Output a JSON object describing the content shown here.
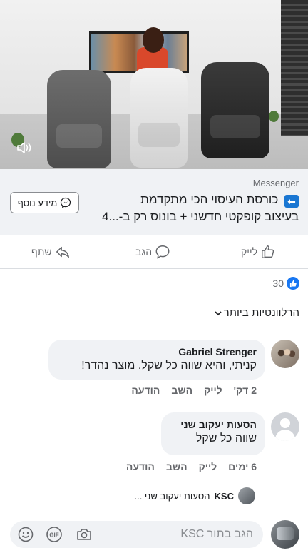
{
  "video": {
    "mute_icon": "speaker-muted-icon"
  },
  "ad": {
    "sponsor": "Messenger",
    "title_line1": "כורסת העיסוי הכי מתקדמת",
    "title_line2": "בעיצוב קופקטי חדשני + בונוס רק ב-...4",
    "arrow_glyph": "⬅",
    "cta_label": "מידע נוסף",
    "cta_icon": "messenger-icon"
  },
  "actions": {
    "like_label": "לייק",
    "comment_label": "הגב",
    "share_label": "שתף"
  },
  "reactions": {
    "count": "30"
  },
  "sort": {
    "label": "הרלוונטיות ביותר"
  },
  "comments": [
    {
      "author": "Gabriel Strenger",
      "text": "קניתי, והיא שווה כל שקל. מוצר נהדר!",
      "time": "2 דק'",
      "like": "לייק",
      "reply": "השב",
      "report": "הודעה"
    },
    {
      "author": "הסעות יעקוב שני",
      "text": "שווה כל שקל",
      "time": "6 ימים",
      "like": "לייק",
      "reply": "השב",
      "report": "הודעה"
    }
  ],
  "reply_preview": {
    "author": "KSC",
    "text": "הסעות יעקוב שני ..."
  },
  "composer": {
    "placeholder": "הגב בתור KSC"
  },
  "colors": {
    "brand_blue": "#1877f2",
    "secondary_text": "#65676b",
    "bubble_bg": "#f0f2f5"
  }
}
